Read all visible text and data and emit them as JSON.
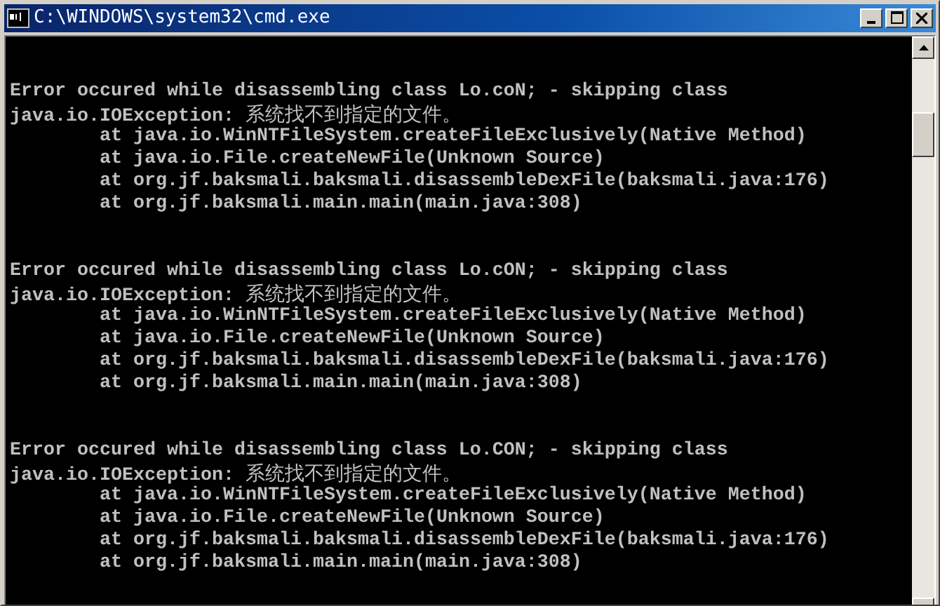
{
  "window": {
    "title": "C:\\WINDOWS\\system32\\cmd.exe"
  },
  "console": {
    "blocks": [
      {
        "error": "Error occured while disassembling class Lo.coN; - skipping class",
        "exception": "java.io.IOException: ",
        "message": "系统找不到指定的文件。",
        "stack": [
          "at java.io.WinNTFileSystem.createFileExclusively(Native Method)",
          "at java.io.File.createNewFile(Unknown Source)",
          "at org.jf.baksmali.baksmali.disassembleDexFile(baksmali.java:176)",
          "at org.jf.baksmali.main.main(main.java:308)"
        ]
      },
      {
        "error": "Error occured while disassembling class Lo.cON; - skipping class",
        "exception": "java.io.IOException: ",
        "message": "系统找不到指定的文件。",
        "stack": [
          "at java.io.WinNTFileSystem.createFileExclusively(Native Method)",
          "at java.io.File.createNewFile(Unknown Source)",
          "at org.jf.baksmali.baksmali.disassembleDexFile(baksmali.java:176)",
          "at org.jf.baksmali.main.main(main.java:308)"
        ]
      },
      {
        "error": "Error occured while disassembling class Lo.CON; - skipping class",
        "exception": "java.io.IOException: ",
        "message": "系统找不到指定的文件。",
        "stack": [
          "at java.io.WinNTFileSystem.createFileExclusively(Native Method)",
          "at java.io.File.createNewFile(Unknown Source)",
          "at org.jf.baksmali.baksmali.disassembleDexFile(baksmali.java:176)",
          "at org.jf.baksmali.main.main(main.java:308)"
        ]
      }
    ]
  }
}
